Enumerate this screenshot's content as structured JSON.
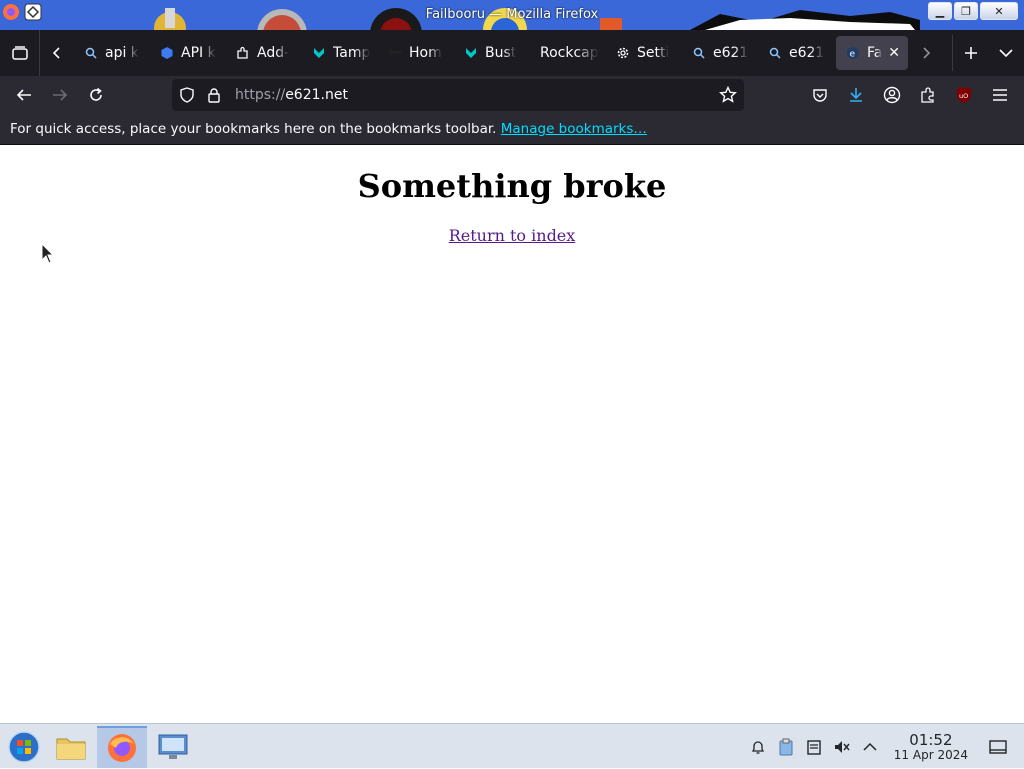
{
  "window": {
    "title": "Failbooru — Mozilla Firefox",
    "controls": {
      "minimize": "▁",
      "maximize": "❐",
      "close": "✕"
    }
  },
  "tabs": [
    {
      "label": "api k",
      "icon": "search-icon"
    },
    {
      "label": "API k",
      "icon": "hexagon-icon"
    },
    {
      "label": "Add-",
      "icon": "puzzle-icon"
    },
    {
      "label": "Tamp",
      "icon": "tampermonkey-icon"
    },
    {
      "label": "Hom",
      "icon": "page-icon"
    },
    {
      "label": "Bust",
      "icon": "tampermonkey-icon"
    },
    {
      "label": "Rockcap",
      "icon": "none"
    },
    {
      "label": "Setti",
      "icon": "gear-icon"
    },
    {
      "label": "e621",
      "icon": "search-icon"
    },
    {
      "label": "e621",
      "icon": "search-icon"
    },
    {
      "label": "Fa",
      "icon": "e621-icon",
      "active": true
    }
  ],
  "navbar": {
    "url_scheme": "https://",
    "url_host": "e621.net"
  },
  "bookmarks_bar": {
    "message": "For quick access, place your bookmarks here on the bookmarks toolbar.",
    "link": "Manage bookmarks…"
  },
  "page": {
    "heading": "Something broke",
    "link": "Return to index"
  },
  "taskbar": {
    "time": "01:52",
    "date": "11 Apr 2024"
  },
  "colors": {
    "accent": "#00ddff",
    "tabstrip": "#1c1b22",
    "toolbar": "#2b2a33",
    "link_visited": "#551a8b"
  }
}
